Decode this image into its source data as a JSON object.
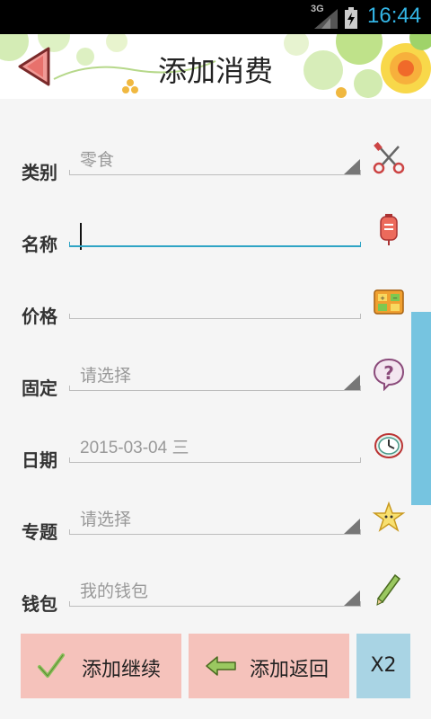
{
  "status_bar": {
    "network": "3G",
    "time": "16:44"
  },
  "header": {
    "title": "添加消费",
    "back_icon": "back-arrow-icon"
  },
  "form": {
    "rows": [
      {
        "label": "类别",
        "value": "零食",
        "type": "select",
        "icon": "scissors-tools-icon"
      },
      {
        "label": "名称",
        "value": "",
        "type": "text",
        "focused": true,
        "icon": "red-tag-icon"
      },
      {
        "label": "价格",
        "value": "",
        "type": "text",
        "icon": "calculator-icon"
      },
      {
        "label": "固定",
        "value": "请选择",
        "type": "select",
        "icon": "question-bubble-icon"
      },
      {
        "label": "日期",
        "value": "2015-03-04  三",
        "type": "date",
        "icon": "clock-icon"
      },
      {
        "label": "专题",
        "value": "请选择",
        "type": "select",
        "icon": "star-icon"
      },
      {
        "label": "钱包",
        "value": "我的钱包",
        "type": "select",
        "icon": "pencil-icon"
      }
    ]
  },
  "actions": {
    "continue_label": "添加继续",
    "return_label": "添加返回",
    "x2_label": "X2"
  },
  "colors": {
    "button_pink": "#f5c2bb",
    "button_blue": "#a9d4e4",
    "focus_line": "#2fa4c5",
    "scrollbar": "#76c4e0",
    "status_text": "#33b5e5"
  }
}
